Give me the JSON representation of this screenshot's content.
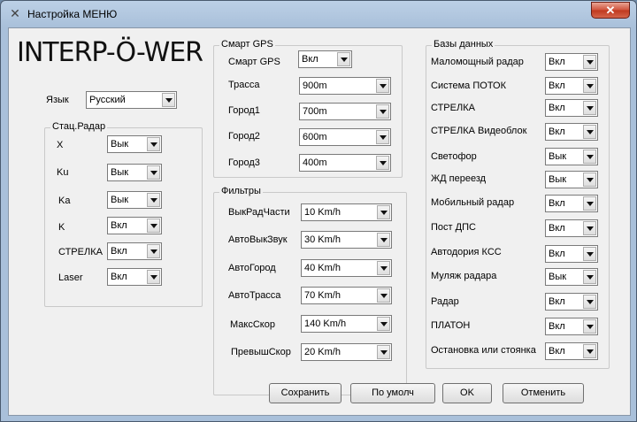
{
  "window": {
    "title": "Настройка МЕНЮ",
    "close_label": "✕"
  },
  "logo_text": "INTERP-Ö-WER",
  "language": {
    "label": "Язык",
    "value": "Русский"
  },
  "stat_radar": {
    "title": "Стац.Радар",
    "rows": [
      {
        "label": "X",
        "value": "Вык"
      },
      {
        "label": "Ku",
        "value": "Вык"
      },
      {
        "label": "Ka",
        "value": "Вык"
      },
      {
        "label": "K",
        "value": "Вкл"
      },
      {
        "label": "СТРЕЛКА",
        "value": "Вкл"
      },
      {
        "label": "Laser",
        "value": "Вкл"
      }
    ]
  },
  "smart_gps": {
    "title": "Смарт GPS",
    "rows": [
      {
        "label": "Смарт GPS",
        "value": "Вкл"
      },
      {
        "label": "Трасса",
        "value": "900m"
      },
      {
        "label": "Город1",
        "value": "700m"
      },
      {
        "label": "Город2",
        "value": "600m"
      },
      {
        "label": "Город3",
        "value": "400m"
      }
    ]
  },
  "filters": {
    "title": "Фильтры",
    "rows": [
      {
        "label": "ВыкРадЧасти",
        "value": "10 Km/h"
      },
      {
        "label": "АвтоВыкЗвук",
        "value": "30 Km/h"
      },
      {
        "label": "АвтоГород",
        "value": "40 Km/h"
      },
      {
        "label": "АвтоТрасса",
        "value": "70 Km/h"
      },
      {
        "label": "МаксСкор",
        "value": "140 Km/h"
      },
      {
        "label": "ПревышСкор",
        "value": "20 Km/h"
      }
    ]
  },
  "databases": {
    "title": "Базы данных",
    "rows": [
      {
        "label": "Маломощный радар",
        "value": "Вкл"
      },
      {
        "label": "Система ПОТОК",
        "value": "Вкл"
      },
      {
        "label": "СТРЕЛКА",
        "value": "Вкл"
      },
      {
        "label": "СТРЕЛКА Видеоблок",
        "value": "Вкл"
      },
      {
        "label": "Светофор",
        "value": "Вык"
      },
      {
        "label": "ЖД переезд",
        "value": "Вык"
      },
      {
        "label": "Мобильный радар",
        "value": "Вкл"
      },
      {
        "label": "Пост ДПС",
        "value": "Вкл"
      },
      {
        "label": "Автодория КСС",
        "value": "Вкл"
      },
      {
        "label": "Муляж радара",
        "value": "Вык"
      },
      {
        "label": "Радар",
        "value": "Вкл"
      },
      {
        "label": "ПЛАТОН",
        "value": "Вкл"
      },
      {
        "label": "Остановка или стоянка",
        "value": "Вкл"
      }
    ]
  },
  "buttons": {
    "save": "Сохранить",
    "defaults": "По умолч",
    "ok": "OK",
    "cancel": "Отменить"
  }
}
